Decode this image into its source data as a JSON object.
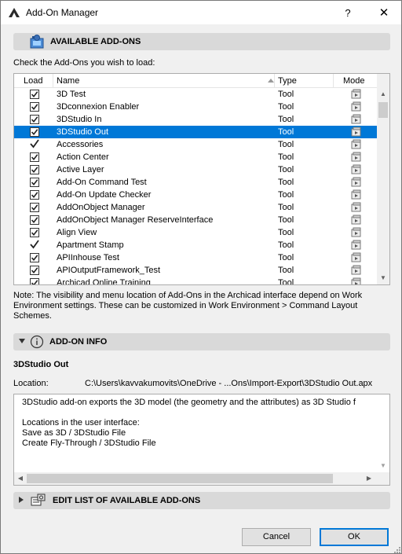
{
  "window": {
    "title": "Add-On Manager",
    "help": "?",
    "close": "✕"
  },
  "available": {
    "header": "AVAILABLE ADD-ONS",
    "instruction": "Check the Add-Ons you wish to load:",
    "columns": {
      "load": "Load",
      "name": "Name",
      "type": "Type",
      "mode": "Mode"
    },
    "rows": [
      {
        "name": "3D Test",
        "type": "Tool",
        "check": "box"
      },
      {
        "name": "3Dconnexion Enabler",
        "type": "Tool",
        "check": "box"
      },
      {
        "name": "3DStudio In",
        "type": "Tool",
        "check": "box"
      },
      {
        "name": "3DStudio Out",
        "type": "Tool",
        "check": "box",
        "selected": true
      },
      {
        "name": "Accessories",
        "type": "Tool",
        "check": "tick"
      },
      {
        "name": "Action Center",
        "type": "Tool",
        "check": "box"
      },
      {
        "name": "Active Layer",
        "type": "Tool",
        "check": "box"
      },
      {
        "name": "Add-On Command Test",
        "type": "Tool",
        "check": "box"
      },
      {
        "name": "Add-On Update Checker",
        "type": "Tool",
        "check": "box"
      },
      {
        "name": "AddOnObject Manager",
        "type": "Tool",
        "check": "box"
      },
      {
        "name": "AddOnObject Manager ReserveInterface",
        "type": "Tool",
        "check": "box"
      },
      {
        "name": "Align View",
        "type": "Tool",
        "check": "box"
      },
      {
        "name": "Apartment Stamp",
        "type": "Tool",
        "check": "tick"
      },
      {
        "name": "APIInhouse Test",
        "type": "Tool",
        "check": "box"
      },
      {
        "name": "APIOutputFramework_Test",
        "type": "Tool",
        "check": "box"
      },
      {
        "name": "Archicad Online Training",
        "type": "Tool",
        "check": "box"
      }
    ],
    "note": "Note: The visibility and menu location of Add-Ons in the Archicad interface depend on Work Environment settings. These can be customized in Work Environment > Command Layout Schemes."
  },
  "info": {
    "header": "ADD-ON INFO",
    "name": "3DStudio Out",
    "location_label": "Location:",
    "location_value": "C:\\Users\\kavvakumovits\\OneDrive - ...Ons\\Import-Export\\3DStudio Out.apx",
    "desc_line1": "3DStudio add-on exports the 3D model (the geometry and the attributes) as 3D Studio f",
    "desc_line2": "",
    "desc_line3": "Locations in the user interface:",
    "desc_line4": "Save as 3D / 3DStudio File",
    "desc_line5": "Create Fly-Through / 3DStudio File"
  },
  "edit": {
    "header": "EDIT LIST OF AVAILABLE ADD-ONS"
  },
  "buttons": {
    "cancel": "Cancel",
    "ok": "OK"
  },
  "colors": {
    "selection": "#0078d7",
    "section_bg": "#d9d9d9"
  }
}
